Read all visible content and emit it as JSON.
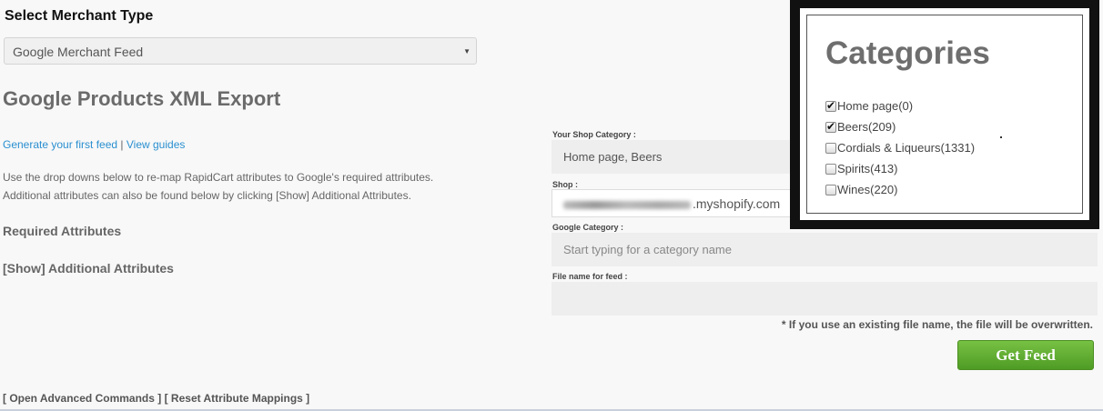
{
  "merchant": {
    "title": "Select Merchant Type",
    "selected": "Google Merchant Feed"
  },
  "export": {
    "title": "Google Products XML Export",
    "link_first_feed": "Generate your first feed",
    "link_separator": " | ",
    "link_guides": "View guides",
    "description_line1": "Use the drop downs below to re-map RapidCart attributes to Google's required attributes.",
    "description_line2": "Additional attributes can also be found below by clicking [Show] Additional Attributes.",
    "required_attributes": "Required Attributes",
    "show_additional": "[Show] Additional Attributes"
  },
  "form": {
    "shop_category_label": "Your Shop Category :",
    "shop_category_value": "Home page, Beers",
    "shop_label": "Shop :",
    "shop_value_suffix": ".myshopify.com",
    "google_category_label": "Google Category :",
    "google_category_placeholder": "Start typing for a category name",
    "file_name_label": "File name for feed :",
    "file_name_value": "",
    "note": "* If you use an existing file name, the file will be overwritten.",
    "get_feed_button": "Get Feed"
  },
  "bottom": {
    "open_advanced": "[ Open Advanced Commands ]",
    "reset_mappings": "[ Reset Attribute Mappings ]"
  },
  "categories": {
    "title": "Categories",
    "items": [
      {
        "label": "Home page(0)",
        "checked": true
      },
      {
        "label": "Beers(209)",
        "checked": true
      },
      {
        "label": "Cordials & Liqueurs(1331)",
        "checked": false
      },
      {
        "label": "Spirits(413)",
        "checked": false
      },
      {
        "label": "Wines(220)",
        "checked": false
      }
    ]
  }
}
